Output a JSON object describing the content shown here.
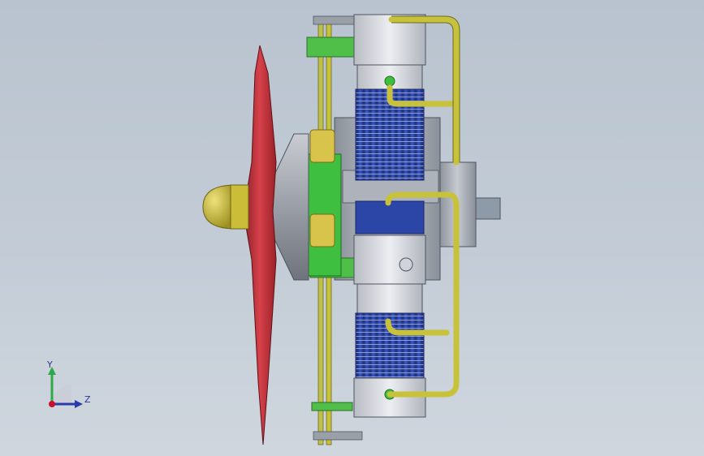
{
  "viewport": {
    "background_top": "#b9c3cf",
    "background_bottom": "#cfd6de"
  },
  "model": {
    "parts": [
      "propeller-blade",
      "spinner-nose",
      "cowl-cone",
      "green-front-plate",
      "cylinder-fins-upper",
      "cylinder-fins-lower",
      "cylinder-head-upper",
      "cylinder-head-lower",
      "exhaust-pipes",
      "crankcase",
      "output-shaft",
      "pushrods"
    ],
    "colors": {
      "propeller": "#c8303a",
      "spinner": "#c8b832",
      "cowl": "#9a9ea6",
      "green_plate": "#3fbf3f",
      "cylinder_fins": "#2c46a8",
      "cylinder_head": "#d9dbe0",
      "exhaust": "#c7c23a",
      "crankcase": "#9da3ad",
      "shaft": "#8e9aa8"
    }
  },
  "triad": {
    "y_label": "Y",
    "z_label": "Z",
    "y_color": "#2fa84a",
    "z_color": "#2a3aa8",
    "x_color": "#c8102e",
    "icon": "coordinate-triad-icon"
  }
}
